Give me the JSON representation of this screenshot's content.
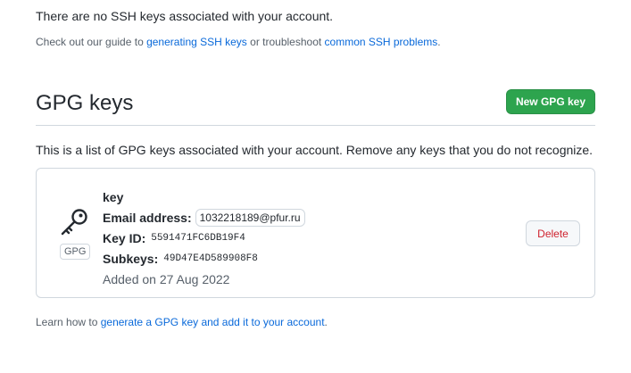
{
  "ssh": {
    "empty_message": "There are no SSH keys associated with your account.",
    "help_prefix": "Check out our guide to ",
    "help_link1": "generating SSH keys",
    "help_middle": " or troubleshoot ",
    "help_link2": "common SSH problems",
    "help_suffix": "."
  },
  "gpg": {
    "title": "GPG keys",
    "new_button": "New GPG key",
    "description": "This is a list of GPG keys associated with your account. Remove any keys that you do not recognize.",
    "key": {
      "icon": "key-icon",
      "badge": "GPG",
      "name": "key",
      "email_label": "Email address:",
      "email": "1032218189@pfur.ru",
      "key_id_label": "Key ID:",
      "key_id": "5591471FC6DB19F4",
      "subkeys_label": "Subkeys:",
      "subkeys": "49D47E4D589908F8",
      "added": "Added on 27 Aug 2022",
      "delete_button": "Delete"
    },
    "learn_prefix": "Learn how to ",
    "learn_link": "generate a GPG key and add it to your account",
    "learn_suffix": "."
  },
  "colors": {
    "primary_button": "#2da44e",
    "link": "#0969da",
    "danger": "#cf222e",
    "border": "#d0d7de"
  }
}
